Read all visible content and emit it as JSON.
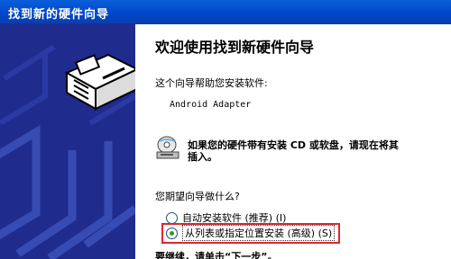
{
  "window": {
    "title": "找到新的硬件向导"
  },
  "colors": {
    "titlebar": "#0046c9",
    "sidepanel": "#1f2c8e",
    "highlight": "#e0262b"
  },
  "icons": {
    "wizard": "hardware-wizard-icon",
    "cd": "cd-drive-icon"
  },
  "content": {
    "heading": "欢迎使用找到新硬件向导",
    "intro": "这个向导帮助您安装软件:",
    "device": "Android Adapter",
    "cd_prompt": "如果您的硬件带有安装 CD 或软盘，请现在将其插入。",
    "question": "您期望向导做什么?",
    "options": [
      {
        "label": "自动安装软件 (推荐) (I)",
        "checked": false
      },
      {
        "label": "从列表或指定位置安装 (高级) (S)",
        "checked": true
      }
    ],
    "footer": "要继续，请单击“下一步”。"
  }
}
